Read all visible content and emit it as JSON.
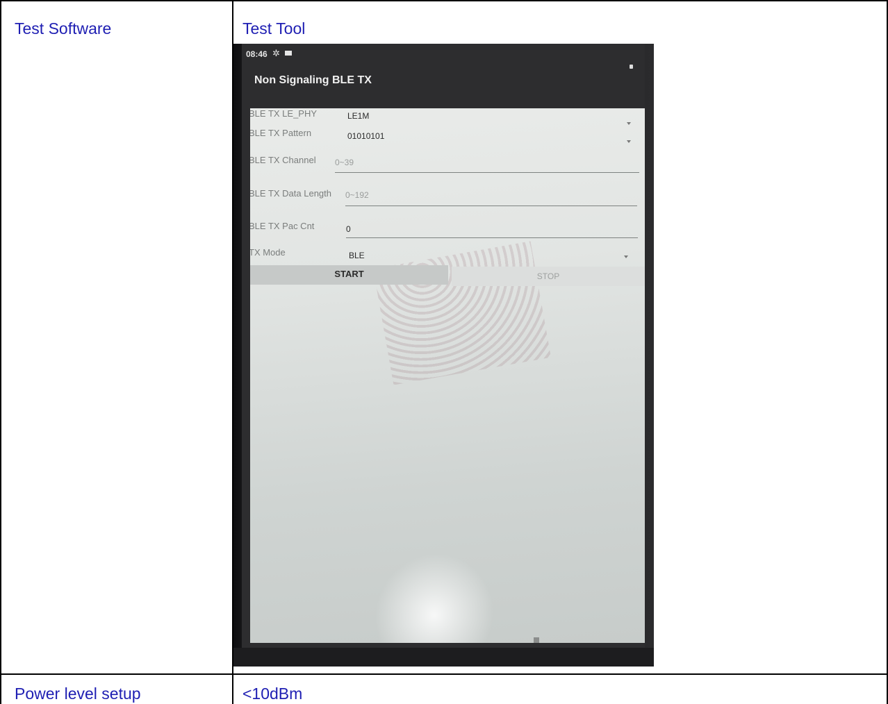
{
  "table": {
    "row1": {
      "label": "Test Software",
      "value": "Test Tool"
    },
    "row2": {
      "label": "Power level setup",
      "value": "<10dBm"
    }
  },
  "device": {
    "status_time": "08:46",
    "screen_title": "Non Signaling BLE TX",
    "fields": {
      "le_phy": {
        "label": "BLE TX LE_PHY",
        "value": "LE1M"
      },
      "pattern": {
        "label": "BLE TX Pattern",
        "value": "01010101"
      },
      "channel": {
        "label": "BLE TX Channel",
        "placeholder": "0~39"
      },
      "data_length": {
        "label": "BLE TX Data Length",
        "placeholder": "0~192"
      },
      "pac_cnt": {
        "label": "BLE TX Pac Cnt",
        "value": "0"
      },
      "tx_mode": {
        "label": "TX Mode",
        "value": "BLE"
      }
    },
    "buttons": {
      "start": "START",
      "stop": "STOP"
    }
  }
}
